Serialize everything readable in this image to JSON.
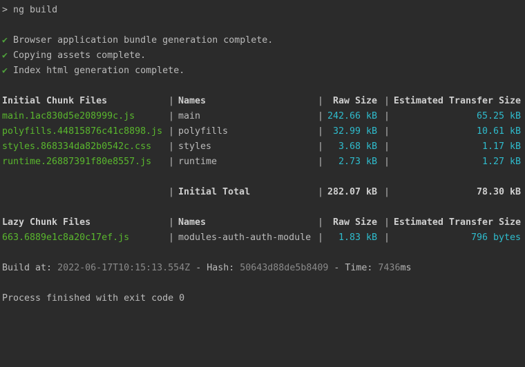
{
  "terminal": {
    "prompt_symbol": ">",
    "command": "ng build",
    "clipped_top_line": "'                    '",
    "status_lines": [
      {
        "mark": "✔",
        "text": "Browser application bundle generation complete."
      },
      {
        "mark": "✔",
        "text": "Copying assets complete."
      },
      {
        "mark": "✔",
        "text": "Index html generation complete."
      }
    ],
    "separator": "|",
    "initial_table": {
      "headers": [
        "Initial Chunk Files",
        "Names",
        "Raw Size",
        "Estimated Transfer Size"
      ],
      "rows": [
        {
          "file": "main.1ac830d5e208999c.js",
          "name": "main",
          "raw": "242.66 kB",
          "est": "65.25 kB"
        },
        {
          "file": "polyfills.44815876c41c8898.js",
          "name": "polyfills",
          "raw": "32.99 kB",
          "est": "10.61 kB"
        },
        {
          "file": "styles.868334da82b0542c.css",
          "name": "styles",
          "raw": "3.68 kB",
          "est": "1.17 kB"
        },
        {
          "file": "runtime.26887391f80e8557.js",
          "name": "runtime",
          "raw": "2.73 kB",
          "est": "1.27 kB"
        }
      ],
      "total": {
        "label": "Initial Total",
        "raw": "282.07 kB",
        "est": "78.30 kB"
      }
    },
    "lazy_table": {
      "headers": [
        "Lazy Chunk Files",
        "Names",
        "Raw Size",
        "Estimated Transfer Size"
      ],
      "rows": [
        {
          "file": "663.6889e1c8a20c17ef.js",
          "name": "modules-auth-auth-module",
          "raw": "1.83 kB",
          "est": "796 bytes"
        }
      ]
    },
    "build_info": {
      "build_at_label": "Build at: ",
      "build_at_value": "2022-06-17T10:15:13.554Z",
      "hash_label": " - Hash: ",
      "hash_value": "50643d88de5b8409",
      "time_label": " - Time: ",
      "time_value": "7436",
      "time_unit": "ms"
    },
    "exit_message": "Process finished with exit code 0"
  },
  "colors": {
    "background": "#2b2b2b",
    "text": "#bbbbbb",
    "check": "#4fa13b",
    "file": "#5ab72e",
    "size": "#2fbccd",
    "muted": "#8a8a8a"
  }
}
